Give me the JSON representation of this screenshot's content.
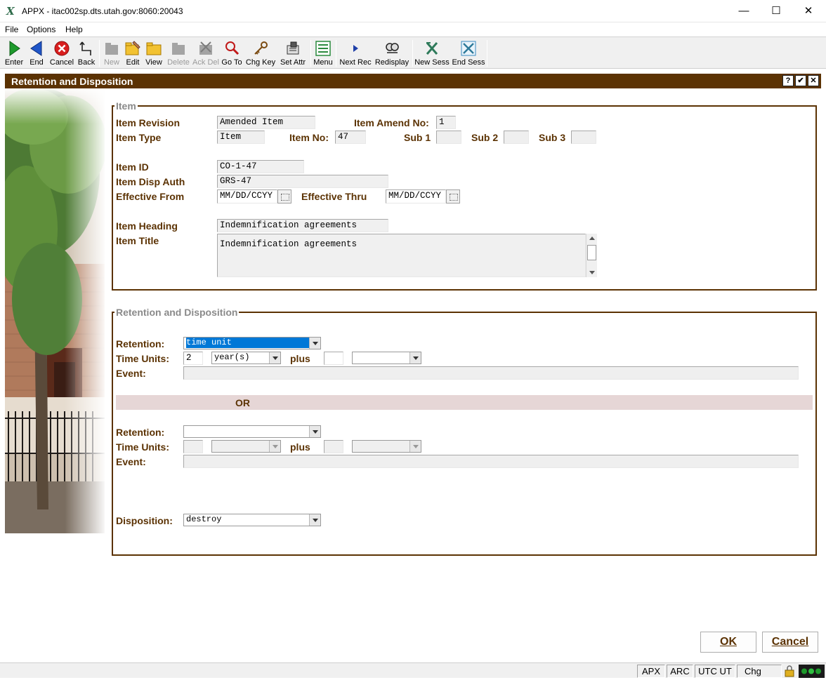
{
  "window": {
    "title": "APPX - itac002sp.dts.utah.gov:8060:20043",
    "minimize": "—",
    "maximize": "☐",
    "close": "✕"
  },
  "menu": [
    "File",
    "Options",
    "Help"
  ],
  "toolbar": [
    {
      "label": "Enter",
      "icon": "enter-arrow-icon",
      "enabled": true
    },
    {
      "label": "End",
      "icon": "end-arrow-icon",
      "enabled": true
    },
    {
      "label": "Cancel",
      "icon": "cancel-icon",
      "enabled": true
    },
    {
      "label": "Back",
      "icon": "back-icon",
      "enabled": true
    },
    {
      "label": "New",
      "icon": "new-icon",
      "enabled": false
    },
    {
      "label": "Edit",
      "icon": "edit-folder-icon",
      "enabled": true
    },
    {
      "label": "View",
      "icon": "view-folder-icon",
      "enabled": true
    },
    {
      "label": "Delete",
      "icon": "delete-icon",
      "enabled": false
    },
    {
      "label": "Ack Del",
      "icon": "ack-delete-icon",
      "enabled": false
    },
    {
      "label": "Go To",
      "icon": "goto-magnifier-icon",
      "enabled": true
    },
    {
      "label": "Chg Key",
      "icon": "change-key-icon",
      "enabled": true
    },
    {
      "label": "Set Attr",
      "icon": "set-attr-icon",
      "enabled": true
    },
    {
      "label": "Menu",
      "icon": "menu-icon",
      "enabled": true
    },
    {
      "label": "Next Rec",
      "icon": "next-record-icon",
      "enabled": true
    },
    {
      "label": "Redisplay",
      "icon": "redisplay-icon",
      "enabled": true
    },
    {
      "label": "New Sess",
      "icon": "new-session-icon",
      "enabled": true
    },
    {
      "label": "End Sess",
      "icon": "end-session-icon",
      "enabled": true
    }
  ],
  "form": {
    "title": "Retention and Disposition",
    "help_btn": "?",
    "ok_btn": "✔",
    "close_btn": "✕"
  },
  "item_group": {
    "legend": "Item",
    "item_revision_label": "Item Revision",
    "item_revision": "Amended Item",
    "item_amend_no_label": "Item Amend No:",
    "item_amend_no": "1",
    "item_type_label": "Item Type",
    "item_type": "Item",
    "item_no_label": "Item No:",
    "item_no": "47",
    "sub1_label": "Sub 1",
    "sub1": "",
    "sub2_label": "Sub 2",
    "sub2": "",
    "sub3_label": "Sub 3",
    "sub3": "",
    "item_id_label": "Item ID",
    "item_id": "CO-1-47",
    "item_disp_auth_label": "Item Disp Auth",
    "item_disp_auth": "GRS-47",
    "effective_from_label": "Effective From",
    "effective_from": "MM/DD/CCYY",
    "effective_thru_label": "Effective Thru",
    "effective_thru": "MM/DD/CCYY",
    "item_heading_label": "Item Heading",
    "item_heading": "Indemnification agreements",
    "item_title_label": "Item Title",
    "item_title": "Indemnification agreements"
  },
  "rd_group": {
    "legend": "Retention and Disposition",
    "retention_label": "Retention:",
    "retention1": "time unit",
    "time_units_label": "Time Units:",
    "time_units1": "2",
    "time_unit_type1": "year(s)",
    "plus_label": "plus",
    "plus1": "",
    "plus_type1": "",
    "event_label": "Event:",
    "event1": "",
    "or_label": "OR",
    "retention2": "",
    "time_units2": "",
    "time_unit_type2": "",
    "plus2": "",
    "plus_type2": "",
    "event2": "",
    "disposition_label": "Disposition:",
    "disposition": "destroy"
  },
  "buttons": {
    "ok": "OK",
    "cancel": "Cancel"
  },
  "status": [
    "APX",
    "ARC",
    "UTC UT",
    "Chg"
  ]
}
